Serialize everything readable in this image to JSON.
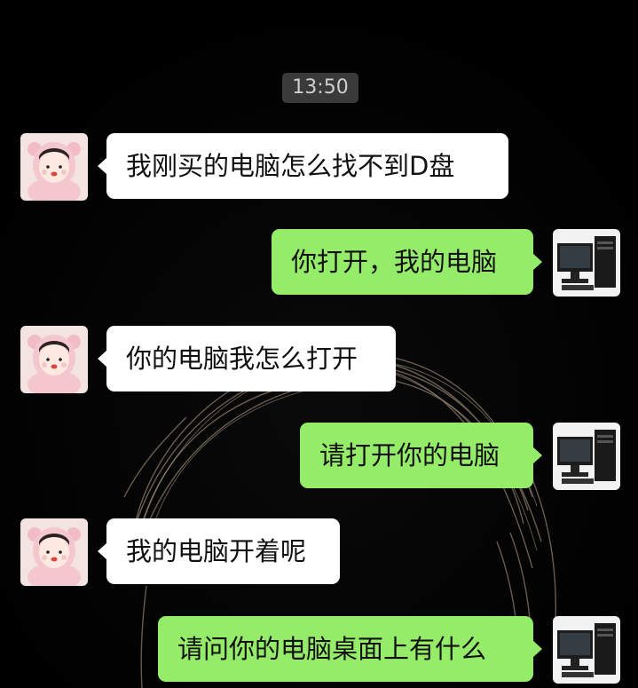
{
  "timestamp": "13:50",
  "colors": {
    "background": "#000000",
    "incoming_bubble": "#ffffff",
    "outgoing_bubble": "#95ec69",
    "timestamp_bg": "#3a3a3a"
  },
  "messages": [
    {
      "side": "left",
      "sender": "girl",
      "avatar": "girl-avatar",
      "text": "我刚买的电脑怎么找不到D盘"
    },
    {
      "side": "right",
      "sender": "computer",
      "avatar": "computer-avatar",
      "text": "你打开，我的电脑"
    },
    {
      "side": "left",
      "sender": "girl",
      "avatar": "girl-avatar",
      "text": "你的电脑我怎么打开"
    },
    {
      "side": "right",
      "sender": "computer",
      "avatar": "computer-avatar",
      "text": "请打开你的电脑"
    },
    {
      "side": "left",
      "sender": "girl",
      "avatar": "girl-avatar",
      "text": "我的电脑开着呢"
    },
    {
      "side": "right",
      "sender": "computer",
      "avatar": "computer-avatar",
      "text": "请问你的电脑桌面上有什么"
    }
  ]
}
